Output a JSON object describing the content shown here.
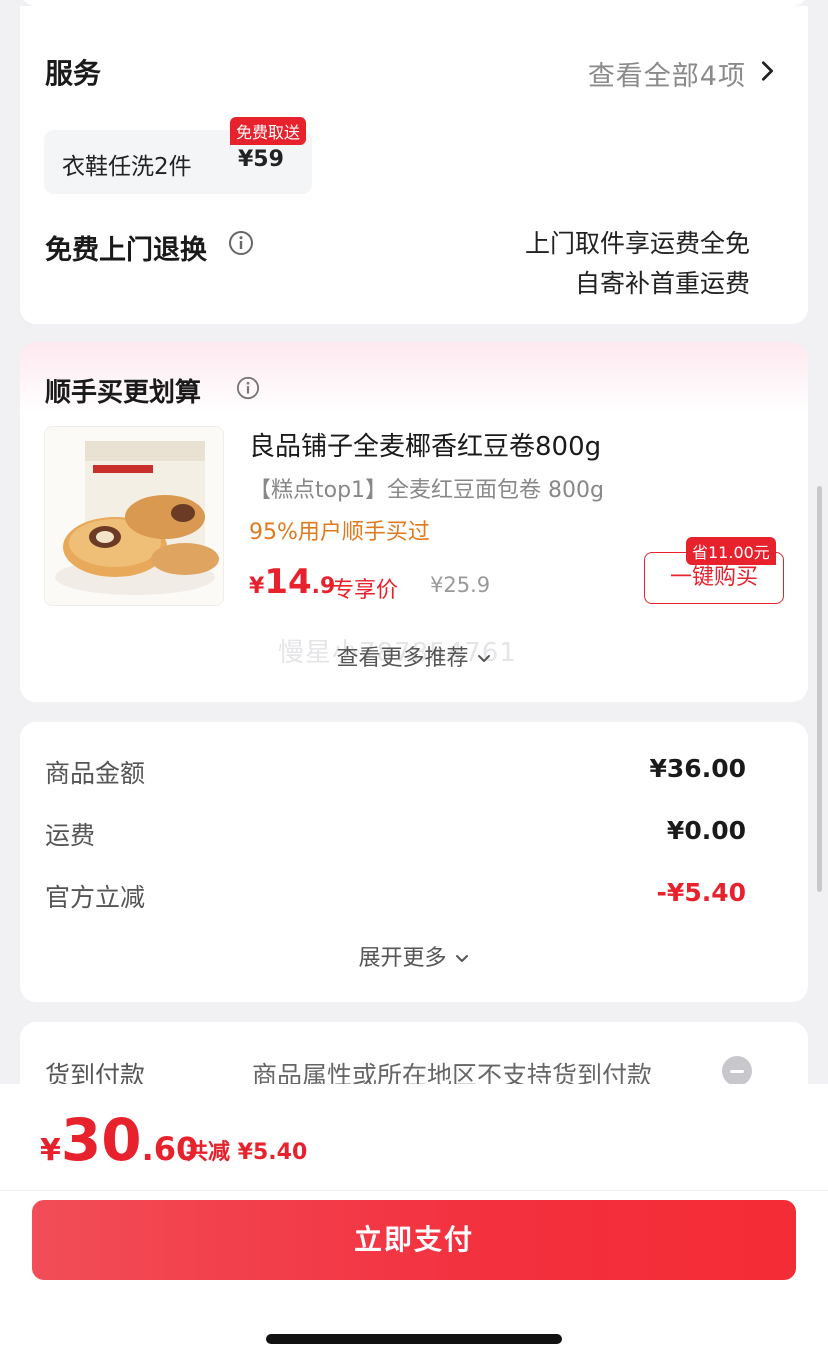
{
  "services": {
    "title": "服务",
    "view_all": "查看全部4项",
    "chip": {
      "name": "衣鞋任洗2件",
      "price": "¥59",
      "badge": "免费取送"
    },
    "free_return_title": "免费上门退换",
    "free_return_line1": "上门取件享运费全免",
    "free_return_line2": "自寄补首重运费"
  },
  "recommend": {
    "title": "顺手买更划算",
    "product_name": "良品铺子全麦椰香红豆卷800g",
    "product_sub": "【糕点top1】全麦红豆面包卷 800g",
    "stat": "95%用户顺手买过",
    "price_currency": "¥",
    "price_int": "14",
    "price_dec": ".9",
    "price_label": "专享价",
    "orig_price": "¥25.9",
    "buy_label": "一键购买",
    "save_badge": "省11.00元",
    "more_label": "查看更多推荐",
    "watermark": "慢星小787854761"
  },
  "amounts": {
    "rows": [
      {
        "label": "商品金额",
        "value": "¥36.00"
      },
      {
        "label": "运费",
        "value": "¥0.00"
      },
      {
        "label": "官方立减",
        "value": "-¥5.40"
      }
    ],
    "more_label": "展开更多"
  },
  "cod": {
    "label": "货到付款",
    "desc": "商品属性或所在地区不支持货到付款"
  },
  "bottom": {
    "currency": "¥",
    "total_int": "30",
    "total_dec": ".60",
    "save_text": "共减 ¥5.40",
    "pay_label": "立即支付"
  },
  "colors": {
    "accent": "#e8222d",
    "orange": "#e07a1f"
  }
}
